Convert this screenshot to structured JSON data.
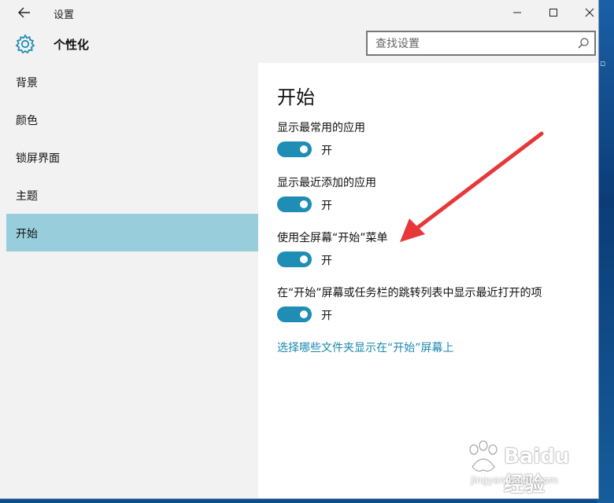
{
  "window": {
    "title": "设置"
  },
  "header": {
    "section_title": "个性化",
    "search_placeholder": "查找设置"
  },
  "sidebar": {
    "items": [
      {
        "label": "背景",
        "active": false
      },
      {
        "label": "颜色",
        "active": false
      },
      {
        "label": "锁屏界面",
        "active": false
      },
      {
        "label": "主题",
        "active": false
      },
      {
        "label": "开始",
        "active": true
      }
    ]
  },
  "content": {
    "title": "开始",
    "settings": [
      {
        "label": "显示最常用的应用",
        "state": "开",
        "on": true
      },
      {
        "label": "显示最近添加的应用",
        "state": "开",
        "on": true
      },
      {
        "label": "使用全屏幕“开始”菜单",
        "state": "开",
        "on": true
      },
      {
        "label": "在“开始”屏幕或任务栏的跳转列表中显示最近打开的项",
        "state": "开",
        "on": true
      }
    ],
    "link": "选择哪些文件夹显示在“开始”屏幕上"
  },
  "watermark": {
    "brand": "Baidu经验",
    "url": "jingyan.baidu.com"
  },
  "colors": {
    "accent": "#1f8db4",
    "active_nav": "#98cedc",
    "link": "#1b87b0",
    "arrow": "#e8373a"
  }
}
